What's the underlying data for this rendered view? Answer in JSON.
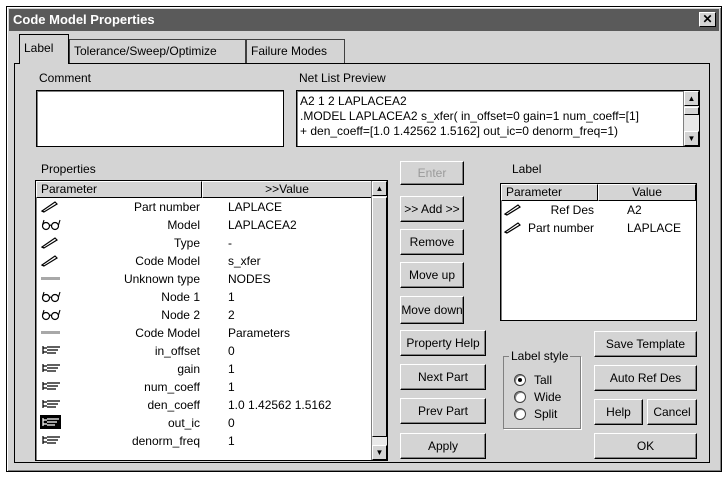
{
  "window": {
    "title": "Code Model Properties",
    "close_glyph": "✕"
  },
  "tabs": [
    {
      "label": "Label",
      "active": true
    },
    {
      "label": "Tolerance/Sweep/Optimize",
      "active": false
    },
    {
      "label": "Failure Modes",
      "active": false
    }
  ],
  "comment": {
    "label": "Comment",
    "value": ""
  },
  "netlist": {
    "label": "Net List Preview",
    "lines": [
      "A2 1 2 LAPLACEA2",
      ".MODEL LAPLACEA2 s_xfer( in_offset=0 gain=1 num_coeff=[1]",
      "+ den_coeff=[1.0 1.42562 1.5162] out_ic=0 denorm_freq=1)"
    ]
  },
  "properties": {
    "label": "Properties",
    "col_param": "Parameter",
    "col_value": ">>Value",
    "rows": [
      {
        "icon": "pencil-icon",
        "name": "Part number",
        "value": "LAPLACE"
      },
      {
        "icon": "glasses-icon",
        "name": "Model",
        "value": "LAPLACEA2"
      },
      {
        "icon": "pencil-icon",
        "name": "Type",
        "value": "-"
      },
      {
        "icon": "pencil-icon",
        "name": "Code Model",
        "value": "s_xfer"
      },
      {
        "icon": "separator-bar-icon",
        "name": "Unknown type",
        "value": "NODES"
      },
      {
        "icon": "glasses-icon",
        "name": "Node 1",
        "value": "1"
      },
      {
        "icon": "glasses-icon",
        "name": "Node 2",
        "value": "2"
      },
      {
        "icon": "separator-bar-icon",
        "name": "Code Model",
        "value": "Parameters"
      },
      {
        "icon": "plug-icon",
        "name": "in_offset",
        "value": "0"
      },
      {
        "icon": "plug-icon",
        "name": "gain",
        "value": "1"
      },
      {
        "icon": "plug-icon",
        "name": "num_coeff",
        "value": "1"
      },
      {
        "icon": "plug-icon",
        "name": "den_coeff",
        "value": "1.0 1.42562 1.5162"
      },
      {
        "icon": "plug-selected-icon",
        "name": "out_ic",
        "value": "0"
      },
      {
        "icon": "plug-icon",
        "name": "denorm_freq",
        "value": "1"
      }
    ]
  },
  "buttons": {
    "enter": "Enter",
    "add": ">> Add >>",
    "remove": "Remove",
    "move_up": "Move up",
    "move_down": "Move down",
    "property_help": "Property Help",
    "next_part": "Next Part",
    "prev_part": "Prev Part",
    "apply": "Apply",
    "save_template": "Save Template",
    "auto_ref_des": "Auto Ref Des",
    "help": "Help",
    "cancel": "Cancel",
    "ok": "OK"
  },
  "label_list": {
    "label": "Label",
    "col_param": "Parameter",
    "col_value": "Value",
    "rows": [
      {
        "icon": "pencil-icon",
        "name": "Ref Des",
        "value": "A2"
      },
      {
        "icon": "pencil-icon",
        "name": "Part number",
        "value": "LAPLACE"
      }
    ]
  },
  "label_style": {
    "label": "Label style",
    "options": [
      "Tall",
      "Wide",
      "Split"
    ],
    "selected": "Tall"
  }
}
